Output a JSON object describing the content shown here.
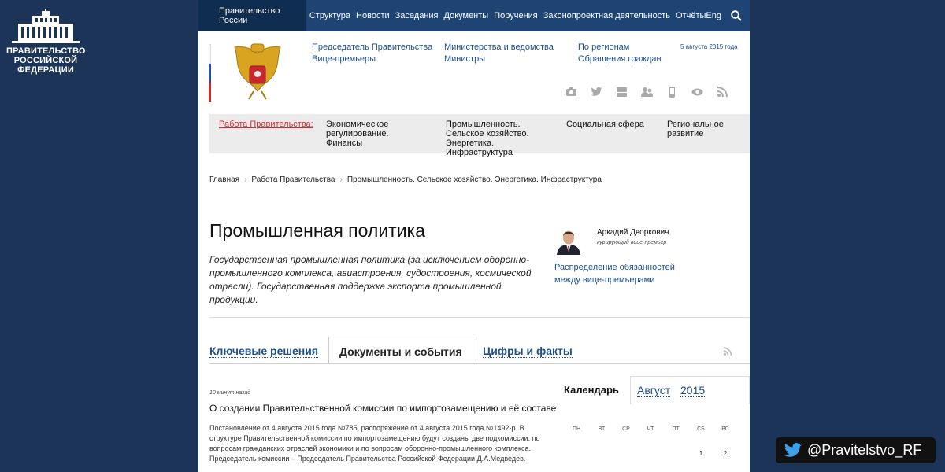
{
  "brand": {
    "lines": [
      "ПРАВИТЕЛЬСТВО",
      "РОССИЙСКОЙ",
      "ФЕДЕРАЦИИ"
    ]
  },
  "twitter": {
    "handle": "@Pravitelstvo_RF"
  },
  "topnav": {
    "home": "Правительство России",
    "items": [
      "Структура",
      "Новости",
      "Заседания",
      "Документы",
      "Поручения",
      "Законопроектная деятельность",
      "Отчёты"
    ],
    "lang": "Eng"
  },
  "header": {
    "links": [
      "Председатель Правительства",
      "Вице-премьеры",
      "Министерства и ведомства",
      "Министры",
      "По регионам",
      "Обращения граждан"
    ],
    "date": "5 августа 2015 года"
  },
  "work": {
    "title": "Работа Правительства:",
    "items": [
      "Экономическое регулирование. Финансы",
      "Промышленность. Сельское хозяйство. Энергетика. Инфраструктура",
      "Социальная сфера",
      "Региональное развитие"
    ]
  },
  "breadcrumb": [
    "Главная",
    "Работа Правительства",
    "Промышленность. Сельское хозяйство. Энергетика. Инфраструктура"
  ],
  "page": {
    "title": "Промышленная политика",
    "description": "Государственная промышленная политика (за исключением оборонно-промышленного комплекса, авиастроения, судостроения, космической отрасли). Государственная поддержка экспорта промышленной продукции."
  },
  "curator": {
    "name": "Аркадий Дворкович",
    "role": "курирующий вице-премьер",
    "link": "Распределение обязанностей между вице-премьерами"
  },
  "tabs": [
    "Ключевые решения",
    "Документы и события",
    "Цифры и факты"
  ],
  "news": {
    "time": "10 минут назад",
    "title": "О создании Правительственной комиссии по импортозамещению и её составе",
    "text": "Постановление от 4 августа 2015 года №785, распоряжение от 4 августа 2015 года №1492-р. В структуре Правительственной комиссии по импортозамещению будут созданы две подкомиссии: по вопросам гражданских отраслей экономики и по вопросам оборонно-промышленного комплекса. Председатель комиссии – Председатель Правительства Российской Федерации Д.А.Медведев."
  },
  "calendar": {
    "title": "Календарь",
    "month": "Август",
    "year": "2015",
    "weekdays": [
      "ПН",
      "ВТ",
      "СР",
      "ЧТ",
      "ПТ",
      "СБ",
      "ВС"
    ],
    "days": [
      "1",
      "2"
    ]
  },
  "colors": {
    "navy": "#1b3457",
    "nav": "#1d4473",
    "link": "#1d4f8c",
    "red": "#e3262d"
  }
}
